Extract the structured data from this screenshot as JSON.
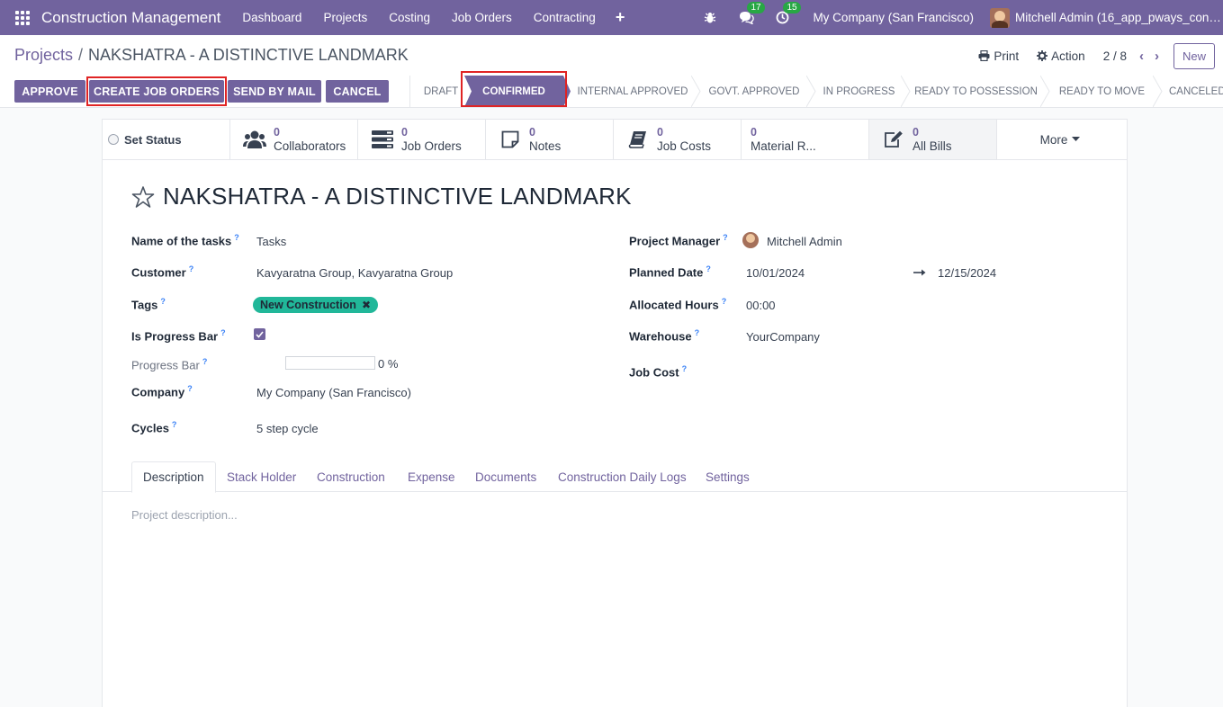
{
  "navbar": {
    "app_name": "Construction Management",
    "menu": [
      "Dashboard",
      "Projects",
      "Costing",
      "Job Orders",
      "Contracting"
    ],
    "messages_count": "17",
    "activities_count": "15",
    "company": "My Company (San Francisco)",
    "user": "Mitchell Admin (16_app_pways_const..."
  },
  "breadcrumb": {
    "parent": "Projects",
    "separator": "/",
    "current": "NAKSHATRA - A DISTINCTIVE LANDMARK"
  },
  "control_panel": {
    "print_label": "Print",
    "action_label": "Action",
    "pager": "2 / 8",
    "new_label": "New"
  },
  "actions": {
    "approve": "APPROVE",
    "create_job_orders": "CREATE JOB ORDERS",
    "send_by_mail": "SEND BY MAIL",
    "cancel": "CANCEL"
  },
  "stages": [
    "DRAFT",
    "CONFIRMED",
    "INTERNAL APPROVED",
    "GOVT. APPROVED",
    "IN PROGRESS",
    "READY TO POSSESSION",
    "READY TO MOVE",
    "CANCELED"
  ],
  "active_stage": "CONFIRMED",
  "smart_buttons": {
    "set_status": "Set Status",
    "collaborators": {
      "value": "0",
      "label": "Collaborators"
    },
    "job_orders": {
      "value": "0",
      "label": "Job Orders"
    },
    "notes": {
      "value": "0",
      "label": "Notes"
    },
    "job_costs": {
      "value": "0",
      "label": "Job Costs"
    },
    "material_requests": {
      "value": "0",
      "label": "Material R..."
    },
    "all_bills": {
      "value": "0",
      "label": "All Bills"
    },
    "more": "More"
  },
  "record": {
    "title": "NAKSHATRA - A DISTINCTIVE LANDMARK"
  },
  "fields": {
    "tasks_name": {
      "label": "Name of the tasks",
      "value": "Tasks"
    },
    "customer": {
      "label": "Customer",
      "value": "Kavyaratna Group, Kavyaratna Group"
    },
    "tags": {
      "label": "Tags",
      "value": "New Construction"
    },
    "is_progress_bar": {
      "label": "Is Progress Bar",
      "checked": true
    },
    "progress_bar": {
      "label": "Progress Bar",
      "value": 0,
      "text": "0 %"
    },
    "company": {
      "label": "Company",
      "value": "My Company (San Francisco)"
    },
    "cycles": {
      "label": "Cycles",
      "value": "5 step cycle"
    },
    "project_manager": {
      "label": "Project Manager",
      "value": "Mitchell Admin"
    },
    "planned_date": {
      "label": "Planned Date",
      "start": "10/01/2024",
      "end": "12/15/2024"
    },
    "allocated_hours": {
      "label": "Allocated Hours",
      "value": "00:00"
    },
    "warehouse": {
      "label": "Warehouse",
      "value": "YourCompany"
    },
    "job_cost": {
      "label": "Job Cost",
      "value": ""
    }
  },
  "help_mark": "?",
  "tabs": [
    "Description",
    "Stack Holder",
    "Construction",
    "Expense",
    "Documents",
    "Construction Daily Logs",
    "Settings"
  ],
  "description_placeholder": "Project description...",
  "colors": {
    "brand": "#71639e",
    "tag": "#21b799",
    "badge": "#28a745",
    "highlight": "#e02424"
  }
}
